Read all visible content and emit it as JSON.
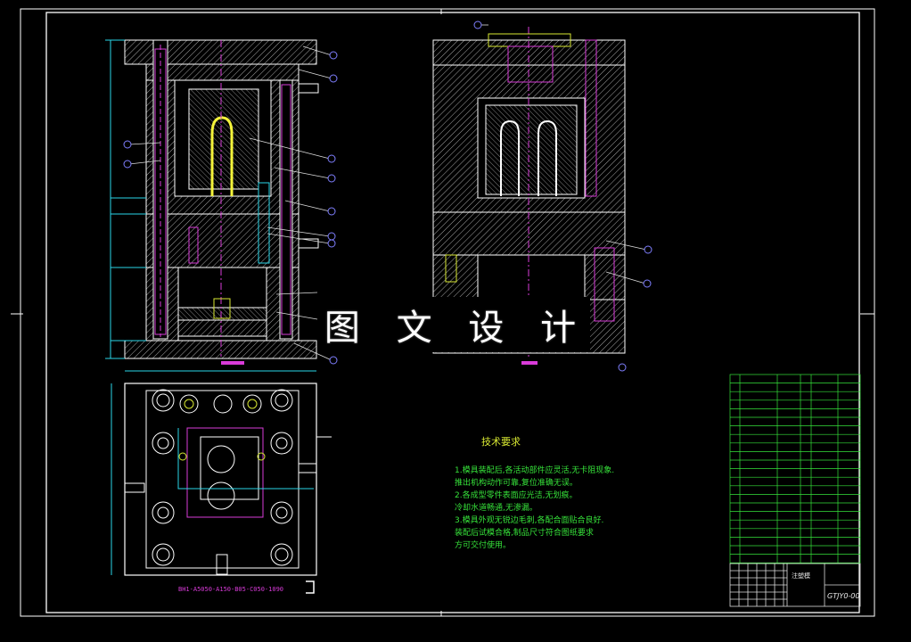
{
  "watermark": "图 文 设 计",
  "technical_requirements": {
    "title": "技术要求",
    "lines": [
      "1.模具装配后,各活动部件应灵活,无卡阻现象.",
      "推出机构动作可靠,复位准确无误。",
      "2.各成型零件表面应光洁,无划痕。",
      "冷却水道畅通,无渗漏。",
      "3.模具外观无锐边毛刺,各配合面贴合良好.",
      "装配后试模合格,制品尺寸符合图纸要求",
      "方可交付使用。"
    ]
  },
  "title_block": {
    "drawing_number": "GTJY0-00",
    "name": "注塑模"
  },
  "part_label": "BH1-A5050-A150-B05-C050-1090",
  "colors": {
    "background": "#000000",
    "frame": "#ffffff",
    "hatch": "#e6e6e6",
    "text_green": "#36e23a",
    "text_yellow": "#d8e832",
    "magenta": "#d93bd9",
    "cyan": "#2ad6e8",
    "balloon": "#7f7fff"
  }
}
